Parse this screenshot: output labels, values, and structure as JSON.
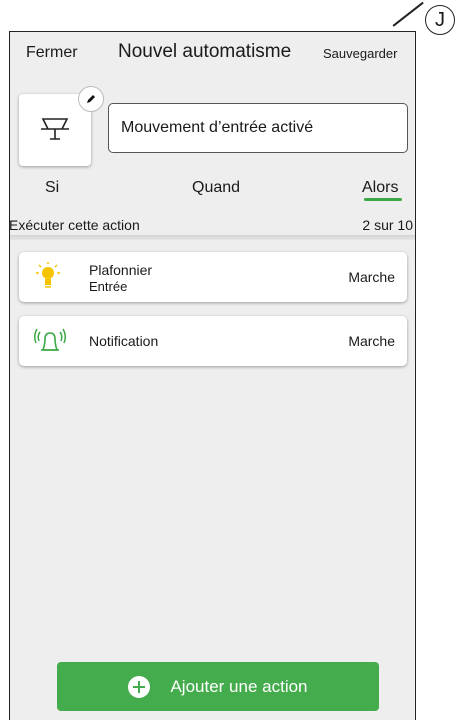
{
  "callout": {
    "label": "J"
  },
  "header": {
    "close_label": "Fermer",
    "title": "Nouvel automatisme",
    "save_label": "Sauvegarder"
  },
  "automation": {
    "name": "Mouvement d’entrée activé",
    "icon": "motion-sensor-icon"
  },
  "tabs": [
    {
      "label": "Si",
      "active": false
    },
    {
      "label": "Quand",
      "active": false
    },
    {
      "label": "Alors",
      "active": true
    }
  ],
  "section": {
    "label": "Exécuter cette action",
    "count": "2 sur 10"
  },
  "actions": [
    {
      "name": "Plafonnier",
      "location": "Entrée",
      "state": "Marche",
      "icon": "lightbulb-icon"
    },
    {
      "name": "Notification",
      "location": "",
      "state": "Marche",
      "icon": "bell-ringing-icon"
    }
  ],
  "add_action": {
    "label": "Ajouter une action"
  },
  "colors": {
    "accent": "#44ac4c",
    "bulb": "#f5c400",
    "bell": "#3aa845"
  }
}
